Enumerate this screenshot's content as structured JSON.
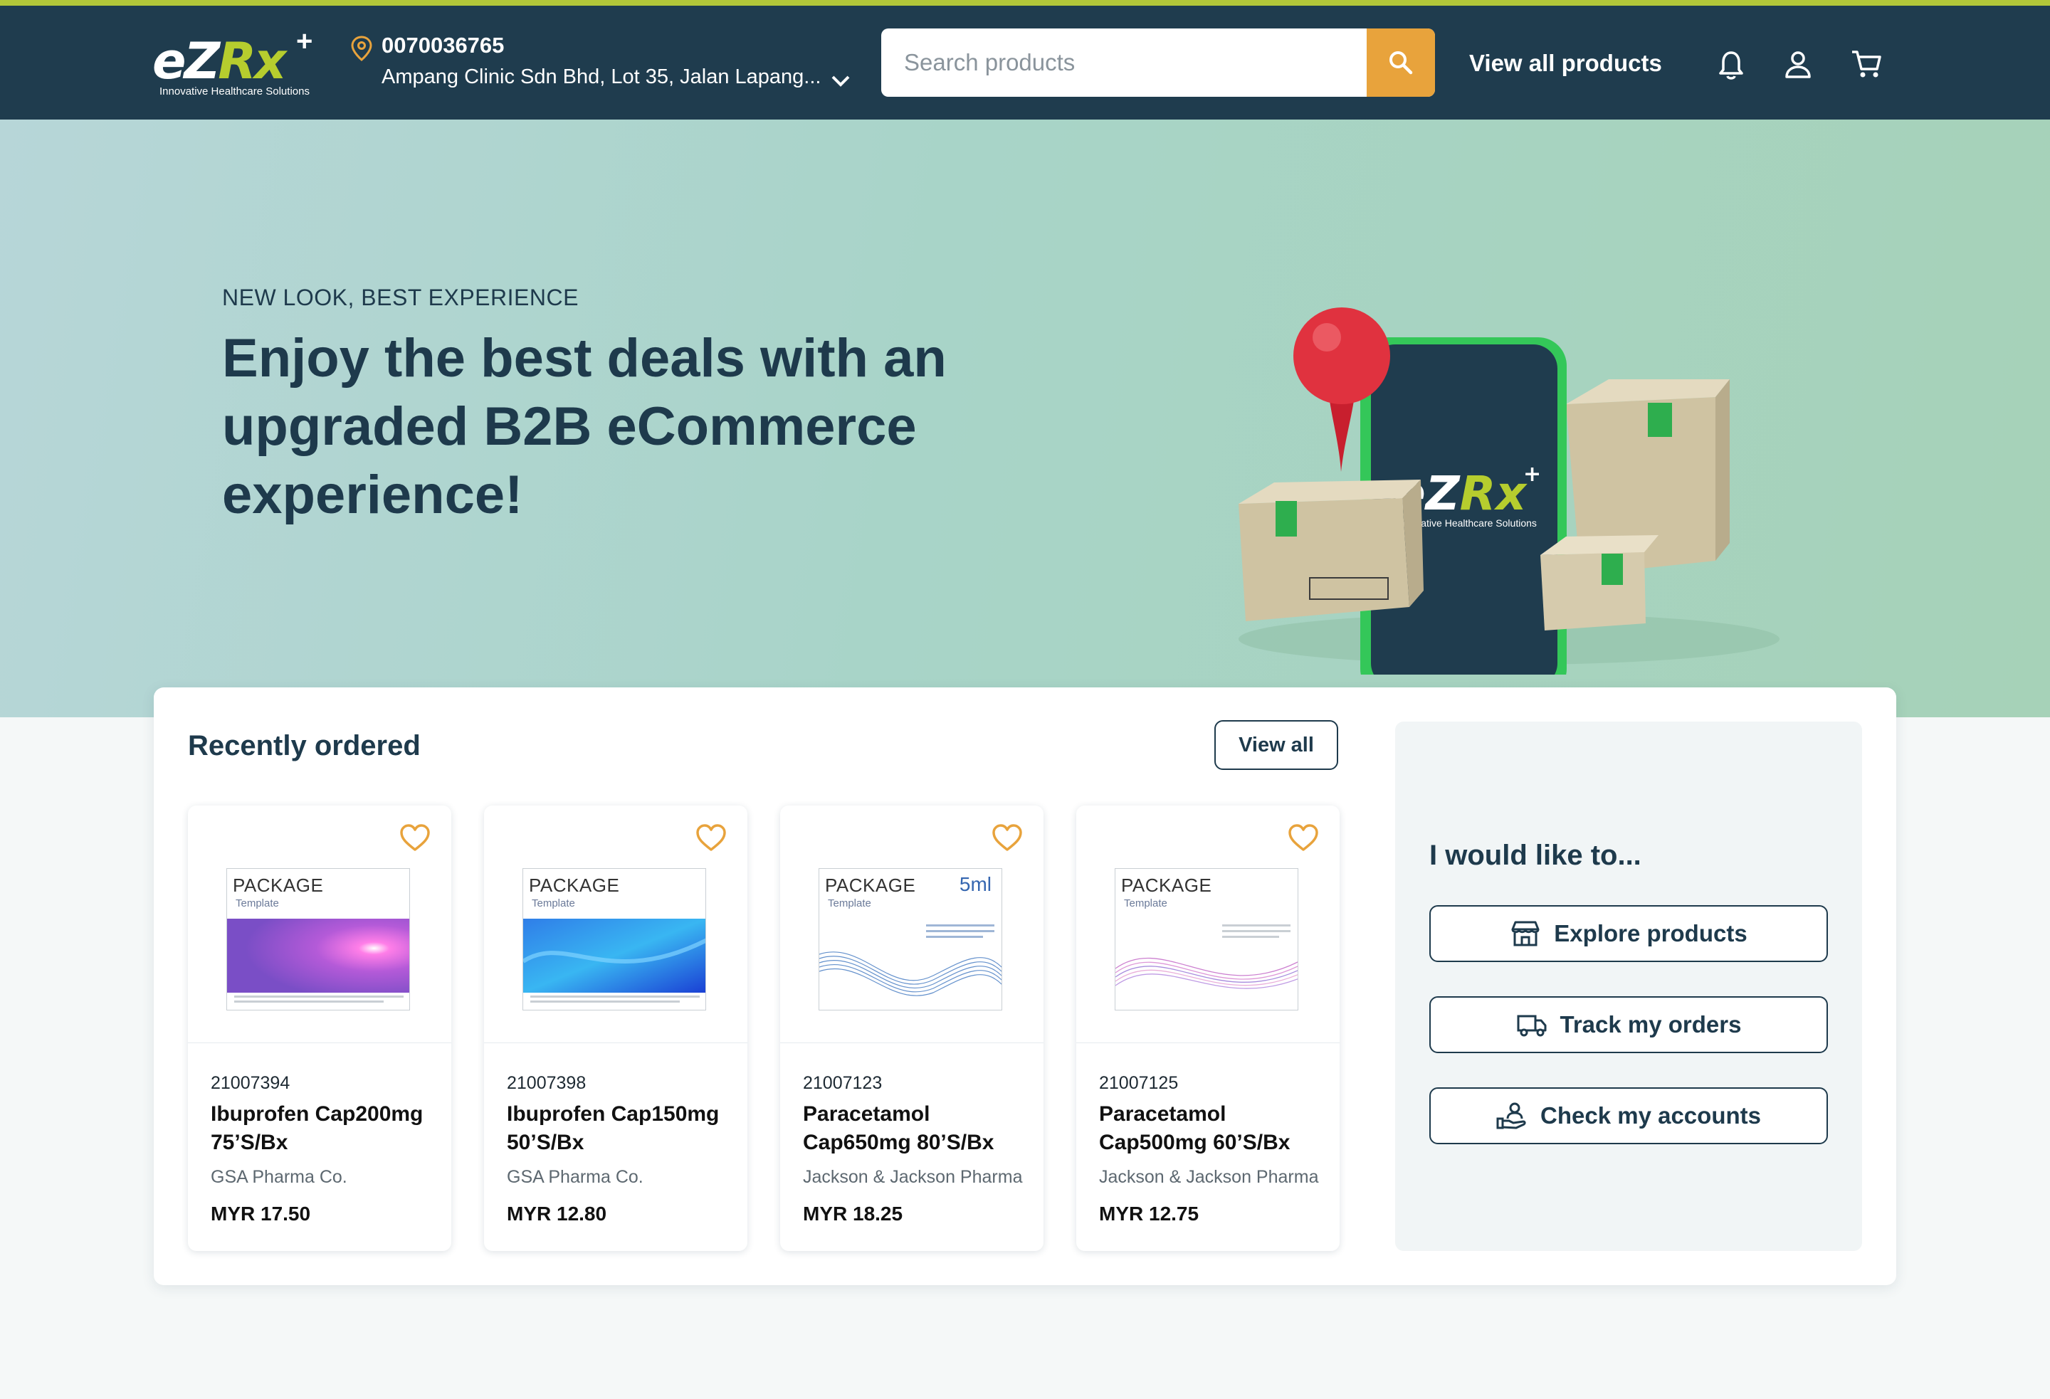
{
  "header": {
    "brand": "eZRx",
    "brand_plus": "+",
    "tagline": "Innovative Healthcare Solutions",
    "account_id": "0070036765",
    "address": "Ampang Clinic Sdn Bhd, Lot 35, Jalan Lapang...",
    "search_placeholder": "Search products",
    "view_all_products": "View all products",
    "icons": [
      "location-pin-icon",
      "chevron-down-icon",
      "search-icon",
      "bell-icon",
      "user-icon",
      "cart-icon"
    ]
  },
  "hero": {
    "eyebrow": "NEW LOOK, BEST EXPERIENCE",
    "title": "Enjoy the best deals with an upgraded B2B eCommerce experience!",
    "phone_brand": "eZRx",
    "phone_tagline": "Innovative Healthcare Solutions"
  },
  "recently_ordered": {
    "title": "Recently ordered",
    "view_all": "View all",
    "products": [
      {
        "code": "21007394",
        "name": "Ibuprofen Cap200mg 75’S/Bx",
        "maker": "GSA Pharma Co.",
        "price": "MYR 17.50",
        "package_title": "PACKAGE",
        "package_sub": "Template",
        "package_ml": ""
      },
      {
        "code": "21007398",
        "name": "Ibuprofen Cap150mg 50’S/Bx",
        "maker": "GSA Pharma Co.",
        "price": "MYR 12.80",
        "package_title": "PACKAGE",
        "package_sub": "Template",
        "package_ml": ""
      },
      {
        "code": "21007123",
        "name": "Paracetamol Cap650mg 80’S/Bx",
        "maker": "Jackson & Jackson Pharma",
        "price": "MYR 18.25",
        "package_title": "PACKAGE",
        "package_sub": "Template",
        "package_ml": "5ml"
      },
      {
        "code": "21007125",
        "name": "Paracetamol Cap500mg 60’S/Bx",
        "maker": "Jackson & Jackson Pharma",
        "price": "MYR 12.75",
        "package_title": "PACKAGE",
        "package_sub": "Template",
        "package_ml": ""
      }
    ]
  },
  "actions": {
    "title": "I would like to...",
    "buttons": [
      {
        "label": "Explore products",
        "icon": "store-icon"
      },
      {
        "label": "Track my orders",
        "icon": "truck-icon"
      },
      {
        "label": "Check my accounts",
        "icon": "hand-user-icon"
      }
    ]
  },
  "colors": {
    "header_bg": "#1f3c4e",
    "accent_line": "#b2c739",
    "search_button": "#e8a33c",
    "heart": "#e8a33c",
    "text_dark": "#1e3a4c"
  }
}
